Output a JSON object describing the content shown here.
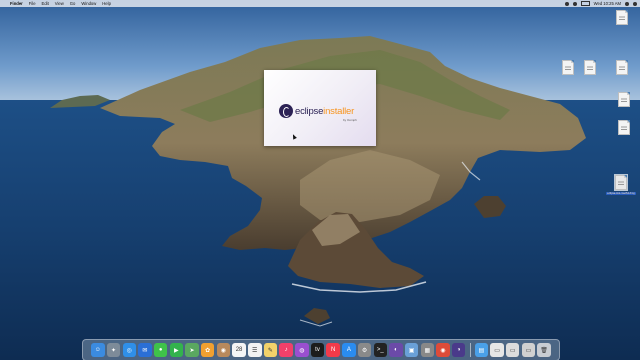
{
  "menubar": {
    "apple": "",
    "app_name": "Finder",
    "menus": [
      "File",
      "Edit",
      "View",
      "Go",
      "Window",
      "Help"
    ],
    "clock": "Wed 10:25 AM"
  },
  "splash": {
    "title_part1": "eclipse",
    "title_part2": "installer",
    "subtitle": "by Oomph"
  },
  "desktop_icons": [
    {
      "label": "",
      "selected": false
    },
    {
      "label": "",
      "selected": false
    },
    {
      "label": "",
      "selected": false
    },
    {
      "label": "",
      "selected": false
    },
    {
      "label": "",
      "selected": false
    },
    {
      "label": "",
      "selected": false
    },
    {
      "label": "eclipse-inst-mac64.dmg",
      "selected": true
    }
  ],
  "dock": {
    "apps": [
      {
        "name": "finder-icon",
        "color": "#3b8be0",
        "glyph": "☺"
      },
      {
        "name": "launchpad-icon",
        "color": "#7d8b99",
        "glyph": "✦"
      },
      {
        "name": "safari-icon",
        "color": "#2f8fe8",
        "glyph": "◎"
      },
      {
        "name": "mail-icon",
        "color": "#2a6fd6",
        "glyph": "✉"
      },
      {
        "name": "messages-icon",
        "color": "#3fc24a",
        "glyph": "●"
      },
      {
        "name": "facetime-icon",
        "color": "#33b34d",
        "glyph": "▶"
      },
      {
        "name": "maps-icon",
        "color": "#5aa860",
        "glyph": "➤"
      },
      {
        "name": "photos-icon",
        "color": "#f0a030",
        "glyph": "✿"
      },
      {
        "name": "contacts-icon",
        "color": "#b8895c",
        "glyph": "◉"
      },
      {
        "name": "calendar-icon",
        "color": "#f5f5f5",
        "glyph": "28"
      },
      {
        "name": "reminders-icon",
        "color": "#f2f2f2",
        "glyph": "☰"
      },
      {
        "name": "notes-icon",
        "color": "#f2d26a",
        "glyph": "✎"
      },
      {
        "name": "music-icon",
        "color": "#f0406a",
        "glyph": "♪"
      },
      {
        "name": "podcasts-icon",
        "color": "#9a4fd0",
        "glyph": "◍"
      },
      {
        "name": "tv-icon",
        "color": "#1c1c1c",
        "glyph": "tv"
      },
      {
        "name": "news-icon",
        "color": "#f23a4a",
        "glyph": "N"
      },
      {
        "name": "app-store-icon",
        "color": "#2a8cf0",
        "glyph": "A"
      },
      {
        "name": "system-preferences-icon",
        "color": "#8a8a8a",
        "glyph": "⚙"
      },
      {
        "name": "terminal-icon",
        "color": "#222222",
        "glyph": ">_"
      },
      {
        "name": "eclipse-icon",
        "color": "#6b4aa8",
        "glyph": "◐"
      },
      {
        "name": "preview-icon",
        "color": "#6aa0d8",
        "glyph": "▣"
      },
      {
        "name": "screenshot-icon",
        "color": "#888888",
        "glyph": "▦"
      },
      {
        "name": "chrome-icon",
        "color": "#dd4b39",
        "glyph": "◉"
      },
      {
        "name": "eclipse-installer-icon",
        "color": "#4a3a8a",
        "glyph": "◑"
      }
    ],
    "right_items": [
      {
        "name": "downloads-folder-icon",
        "color": "#4aa0e8",
        "glyph": "▤"
      },
      {
        "name": "document-stack-icon",
        "color": "#e6e6e6",
        "glyph": "▭"
      },
      {
        "name": "document-stack-icon-2",
        "color": "#dcdcdc",
        "glyph": "▭"
      },
      {
        "name": "document-stack-icon-3",
        "color": "#d0d0d0",
        "glyph": "▭"
      },
      {
        "name": "trash-icon",
        "color": "#c8ccd2",
        "glyph": "🗑"
      }
    ]
  }
}
